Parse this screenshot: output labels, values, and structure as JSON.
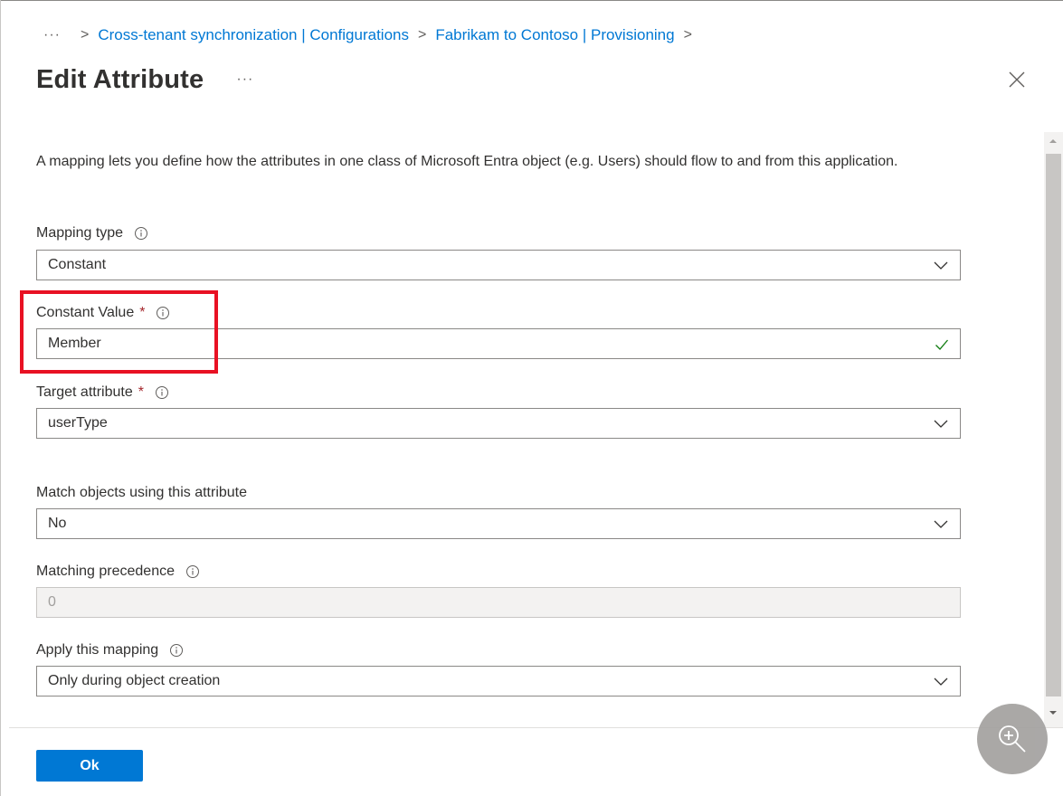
{
  "breadcrumb": {
    "more": "···",
    "items": [
      "Cross-tenant synchronization | Configurations",
      "Fabrikam to Contoso | Provisioning"
    ],
    "separator": ">"
  },
  "header": {
    "title": "Edit Attribute",
    "more": "···"
  },
  "description": "A mapping lets you define how the attributes in one class of Microsoft Entra object (e.g. Users) should flow to and from this application.",
  "form": {
    "mapping_type": {
      "label": "Mapping type",
      "value": "Constant"
    },
    "constant_value": {
      "label": "Constant Value",
      "required": "*",
      "value": "Member"
    },
    "target_attribute": {
      "label": "Target attribute",
      "required": "*",
      "value": "userType"
    },
    "match_objects": {
      "label": "Match objects using this attribute",
      "value": "No"
    },
    "matching_precedence": {
      "label": "Matching precedence",
      "value": "0"
    },
    "apply_mapping": {
      "label": "Apply this mapping",
      "value": "Only during object creation"
    }
  },
  "footer": {
    "ok_label": "Ok"
  },
  "colors": {
    "accent": "#0078d4",
    "highlight": "#e81123",
    "success": "#107c10",
    "required": "#a4262c"
  },
  "icons": [
    "more-icon",
    "chevron-right-icon",
    "close-icon",
    "info-icon",
    "chevron-down-icon",
    "checkmark-icon",
    "zoom-in-icon"
  ]
}
